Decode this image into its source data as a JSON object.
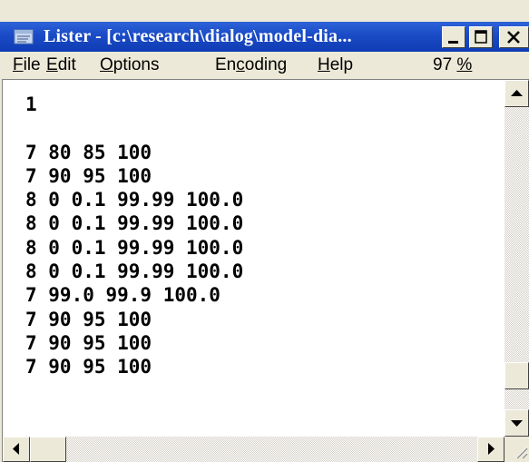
{
  "window": {
    "title": "Lister - [c:\\research\\dialog\\model-dia..."
  },
  "menubar": {
    "items": [
      {
        "label": "File",
        "accel": "F",
        "rest": "ile"
      },
      {
        "label": "Edit",
        "accel": "E",
        "rest": "dit"
      },
      {
        "label": "Options",
        "accel": "O",
        "rest": "ptions"
      },
      {
        "label": "Encoding",
        "pre": "En",
        "accel": "c",
        "rest": "oding"
      },
      {
        "label": "Help",
        "accel": "H",
        "rest": "elp"
      }
    ],
    "zoom": {
      "number": "97 ",
      "percent": "%"
    }
  },
  "content": {
    "lines": [
      "1",
      "",
      "7 80 85 100",
      "7 90 95 100",
      "8 0 0.1 99.99 100.0",
      "8 0 0.1 99.99 100.0",
      "8 0 0.1 99.99 100.0",
      "8 0 0.1 99.99 100.0",
      "7 99.0 99.9 100.0",
      "7 90 95 100",
      "7 90 95 100",
      "7 90 95 100"
    ]
  },
  "icons": {
    "app": "lister-app-icon",
    "minimize": "minimize-icon",
    "maximize": "maximize-icon",
    "close": "close-icon",
    "scroll_up": "arrow-up-icon",
    "scroll_down": "arrow-down-icon",
    "scroll_left": "arrow-left-icon",
    "scroll_right": "arrow-right-icon",
    "resize": "resize-grip-icon"
  },
  "colors": {
    "titlebar": "#1a4bc6",
    "title_text": "#ffffff",
    "chrome": "#ece9d8",
    "text": "#000000",
    "background": "#ffffff"
  }
}
